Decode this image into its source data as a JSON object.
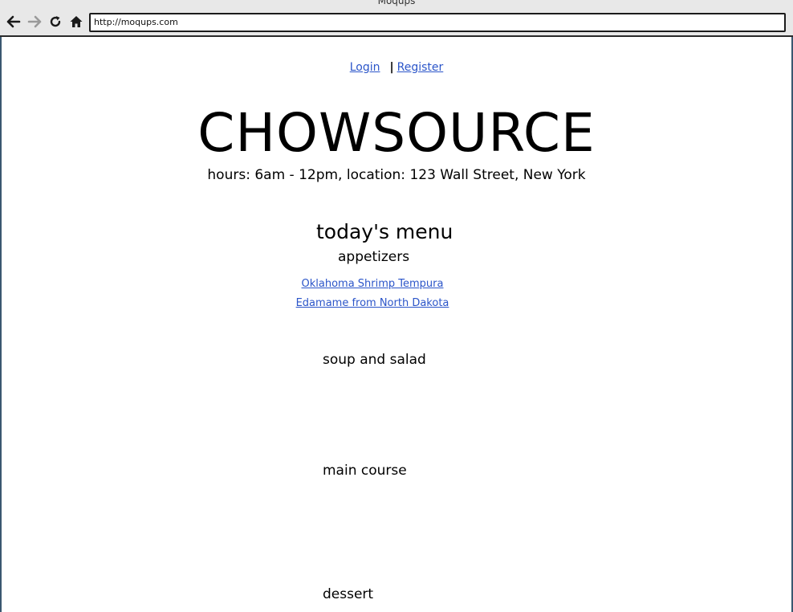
{
  "window": {
    "title": "Moqups"
  },
  "browser": {
    "url": "http://moqups.com",
    "icons": [
      "back-arrow-icon",
      "forward-arrow-icon",
      "reload-icon",
      "home-icon"
    ]
  },
  "auth": {
    "login": "Login",
    "separator": "|",
    "register": "Register"
  },
  "header": {
    "brand": "CHOWSOURCE",
    "info": "hours: 6am - 12pm, location: 123 Wall Street, New York"
  },
  "menu": {
    "title": "today's menu",
    "sections": [
      {
        "label": "appetizers",
        "items": [
          "Oklahoma Shrimp Tempura",
          "Edamame from North Dakota"
        ]
      },
      {
        "label": "soup and salad",
        "items": []
      },
      {
        "label": "main course",
        "items": []
      },
      {
        "label": "dessert",
        "items": []
      }
    ]
  },
  "colors": {
    "link": "#2b55c9",
    "chrome": "#e8e8e8",
    "frame": "#3a5870"
  }
}
